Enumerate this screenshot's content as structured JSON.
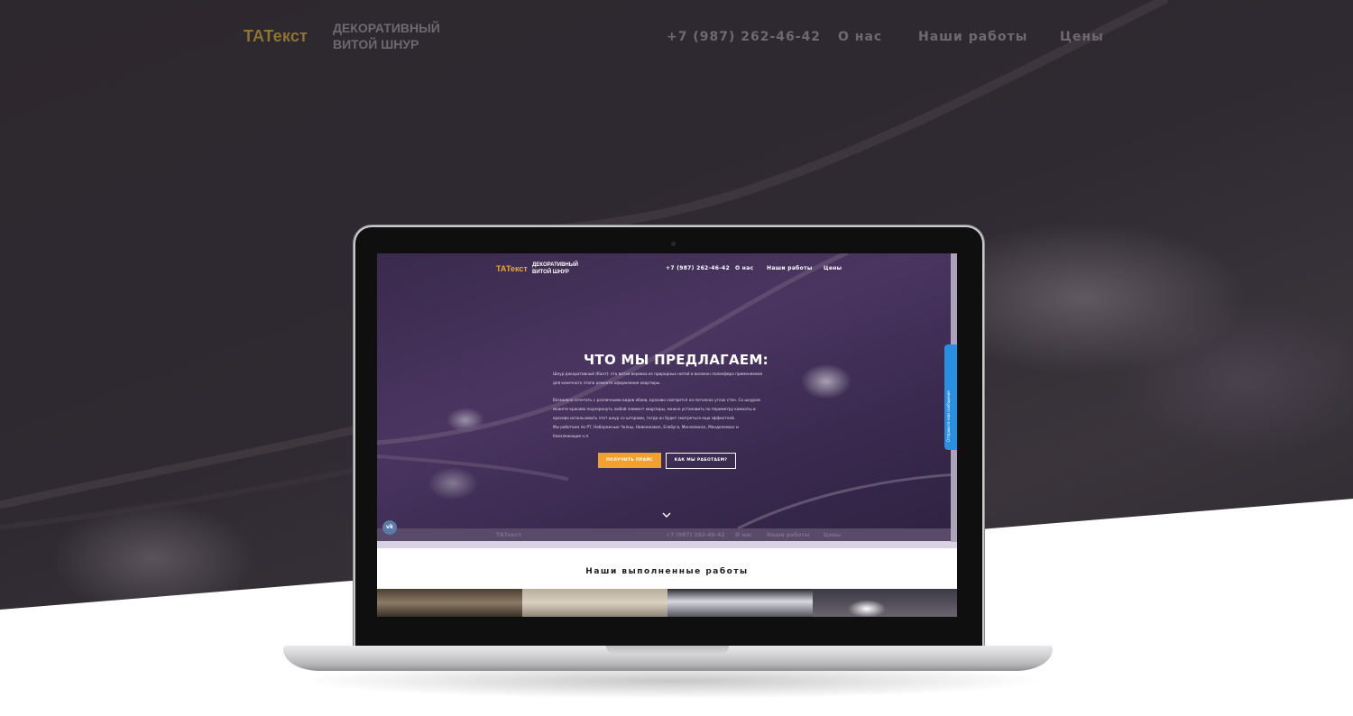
{
  "page": {
    "brand": "ТАТекст",
    "tagline": "ДЕКОРАТИВНЫЙ\nВИТОЙ ШНУР",
    "nav": {
      "phone": "+7 (987) 262-46-42",
      "about": "О нас",
      "works": "Наши работы",
      "prices": "Цены"
    }
  },
  "screen": {
    "brand": "ТАТекст",
    "tagline": "ДЕКОРАТИВНЫЙ\nВИТОЙ ШНУР",
    "nav": {
      "phone": "+7 (987) 262-46-42",
      "about": "О нас",
      "works": "Наши работы",
      "prices": "Цены"
    },
    "hero": {
      "title": "ЧТО МЫ ПРЕДЛАГАЕМ:",
      "lines": [
        "Шнур декоративный (Кант)- это витая веревка из природных нитей и волокон полиэфира применяемая",
        "для конечного этапа ремонта оформления квартиры.",
        "",
        "Возможно сочетать с различными видов обоев, красиво смотрится на потолках углах стен. Со шнуром",
        "можете красиво подчеркнуть любой элемент квартиры, можно установить по периметру комнаты и",
        "красиво использовать этот шнур со шторами, тогда он будет смотреться еще эффектней.",
        "Мы работаем по РТ, Набережные Челны, Нижнекамск, Елабуга, Мензелинск, Менделеевск и",
        "близлежащие н.п."
      ],
      "primary_button": "ПОЛУЧИТЬ ПРАЙС",
      "secondary_button": "КАК МЫ РАБОТАЕМ?",
      "vk_label": "vk"
    },
    "widget_text": "Отправьте нам сообщение",
    "works_title": "Наши выполненные работы"
  },
  "colors": {
    "brand_gold": "#8d7433",
    "screen_brand": "#e8a63a",
    "accent_button": "#f2a02e",
    "widget_blue": "#2a8fe0"
  },
  "icons": [
    "chevron-down-icon",
    "vk-icon",
    "chat-icon"
  ]
}
